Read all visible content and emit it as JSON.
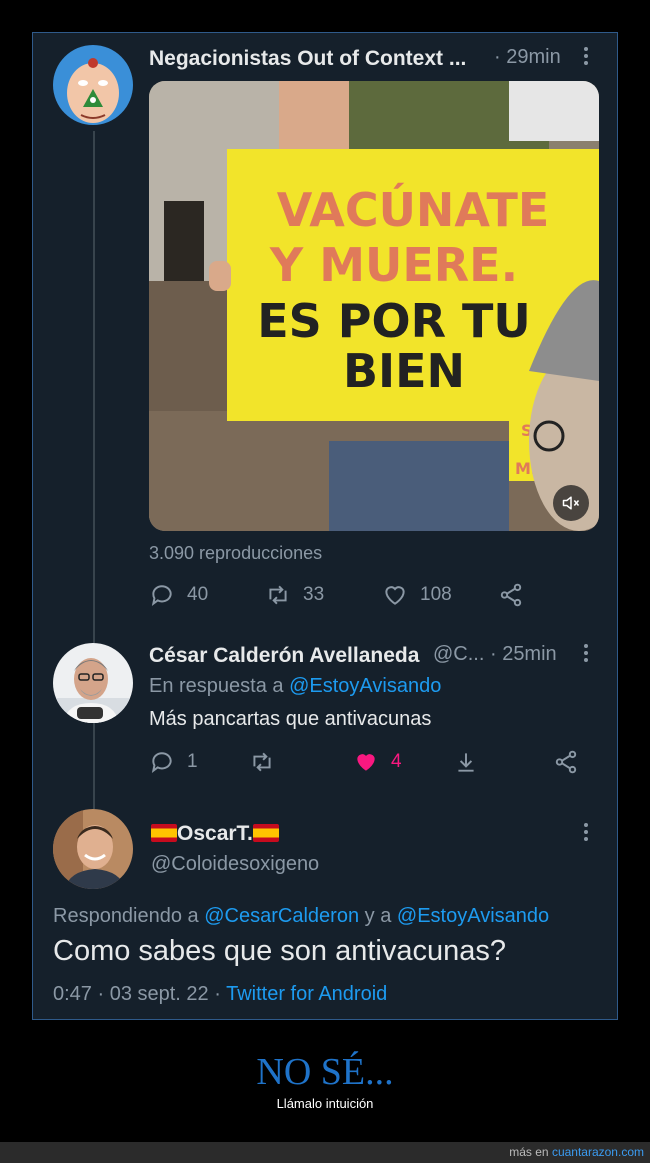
{
  "tweet1": {
    "display_name": "Negacionistas Out of Context ...",
    "time": "· 29min",
    "sign": {
      "line1": "VACÚNATE",
      "line2": "Y MUERE.",
      "line3": "ES POR TU",
      "line4": "BIEN",
      "corner1": "S",
      "corner2": "ME"
    },
    "views": "3.090 reproducciones",
    "actions": {
      "replies": "40",
      "retweets": "33",
      "likes": "108"
    }
  },
  "tweet2": {
    "display_name": "César Calderón Avellaneda",
    "handle_time": "@C... · 25min",
    "reply_prefix": "En respuesta a",
    "reply_to": "@EstoyAvisando",
    "text": "Más pancartas que antivacunas",
    "actions": {
      "replies": "1",
      "likes": "4"
    }
  },
  "tweet3": {
    "display_name": "OscarT.",
    "handle": "@Coloidesoxigeno",
    "reply_prefix": "Respondiendo a",
    "reply_user1": "@CesarCalderon",
    "reply_and": "y a",
    "reply_user2": "@EstoyAvisando",
    "text": "Como sabes que son antivacunas?",
    "datetime": "0:47 · 03 sept. 22 ·",
    "source": "Twitter for Android"
  },
  "caption": {
    "title": "NO SÉ...",
    "subtitle": "Llámalo intuición"
  },
  "footer": {
    "prefix": "más en",
    "site": "cuantarazon.com"
  },
  "colors": {
    "accent": "#1d9bf0",
    "like": "#f91880",
    "background": "#15202b",
    "muted": "#8b98a5"
  },
  "icons": [
    "reply-icon",
    "retweet-icon",
    "heart-icon",
    "share-icon",
    "download-icon",
    "mute-icon",
    "more-icon",
    "spain-flag-icon"
  ]
}
